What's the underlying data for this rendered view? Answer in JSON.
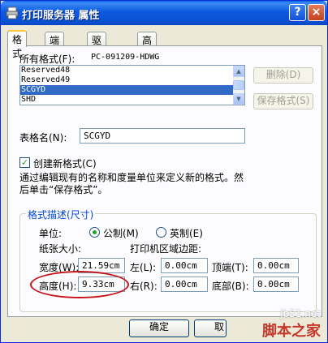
{
  "window": {
    "title": "打印服务器 属性",
    "help_label": "?",
    "close_label": "×"
  },
  "tabs": [
    "格式",
    "端口",
    "驱动程序",
    "高级"
  ],
  "forms": {
    "all_forms_label": "所有格式(F):",
    "server_name": "PC-091209-HDWG",
    "list_items": [
      "Reserved48",
      "Reserved49",
      "SCGYD",
      "SHD"
    ],
    "selected_item": "SCGYD",
    "delete_button": "删除(D)",
    "save_button": "保存格式(S)",
    "form_name_label": "表格名(N):",
    "form_name_value": "SCGYD",
    "create_new_label": "创建新格式(C)",
    "create_new_checked": true,
    "description": "通过编辑现有的名称和度量单位来定义新的格式。然后单击“保存格式”。"
  },
  "measurements": {
    "group_title": "格式描述(尺寸)",
    "unit_label": "单位:",
    "metric_label": "公制(M)",
    "english_label": "英制(E)",
    "selected_unit": "metric",
    "paper_size_label": "纸张大小:",
    "margins_label": "打印机区域边距:",
    "width_label": "宽度(W):",
    "width_value": "21.59cm",
    "height_label": "高度(H):",
    "height_value": "9.33cm",
    "left_label": "左(L):",
    "left_value": "0.00cm",
    "right_label": "右(R):",
    "right_value": "0.00cm",
    "top_label": "顶端(T):",
    "top_value": "0.00cm",
    "bottom_label": "底部(B):",
    "bottom_value": "0.00cm"
  },
  "footer": {
    "ok_button": "确定",
    "cancel_button": "取"
  },
  "watermark": {
    "url": "jb51.net",
    "text": "脚本之家"
  },
  "colors": {
    "title_bar": "#0a5fe8",
    "selection": "#316ac5",
    "highlight_ellipse": "#c8141b",
    "group_title": "#0046d5"
  }
}
